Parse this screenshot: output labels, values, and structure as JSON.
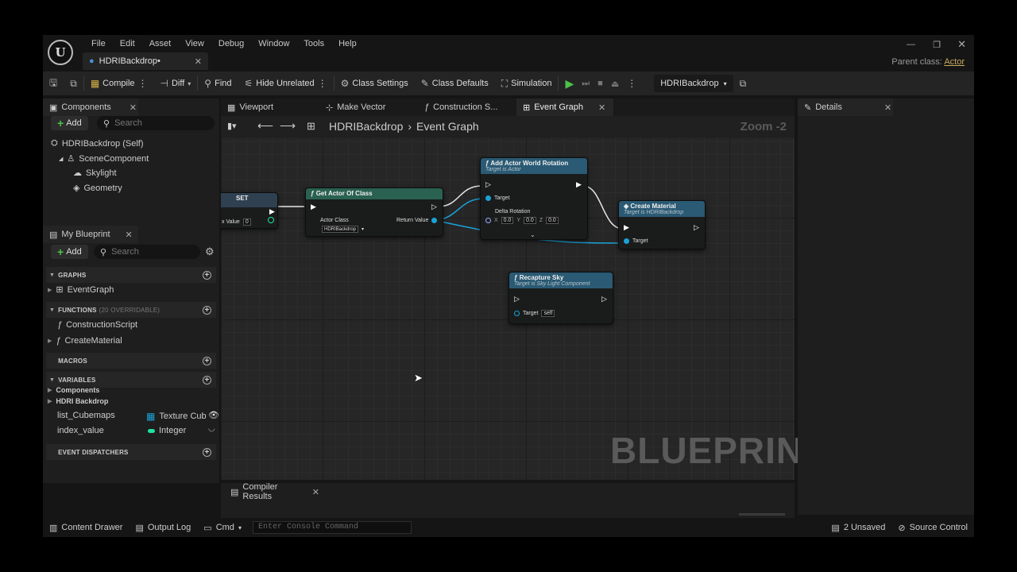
{
  "app": {
    "logo_letter": "U",
    "menu": [
      "File",
      "Edit",
      "Asset",
      "View",
      "Debug",
      "Window",
      "Tools",
      "Help"
    ],
    "doc_tab": "HDRIBackdrop•",
    "parent_class_label": "Parent class:",
    "parent_class_value": "Actor"
  },
  "toolbar": {
    "compile": "Compile",
    "diff": "Diff",
    "find": "Find",
    "hide_unrelated": "Hide Unrelated",
    "class_settings": "Class Settings",
    "class_defaults": "Class Defaults",
    "simulation": "Simulation",
    "debug_object": "HDRIBackdrop"
  },
  "components_panel": {
    "title": "Components",
    "add": "Add",
    "search_placeholder": "Search",
    "tree": [
      "HDRIBackdrop (Self)",
      "SceneComponent",
      "Skylight",
      "Geometry"
    ]
  },
  "my_blueprint": {
    "title": "My Blueprint",
    "add": "Add",
    "search_placeholder": "Search",
    "graphs_header": "GRAPHS",
    "graphs": [
      "EventGraph"
    ],
    "functions_header": "FUNCTIONS",
    "functions_overridable": "(20 OVERRIDABLE)",
    "functions": [
      "ConstructionScript",
      "CreateMaterial"
    ],
    "macros_header": "MACROS",
    "variables_header": "VARIABLES",
    "variable_categories": [
      "Components",
      "HDRI Backdrop"
    ],
    "variables": [
      {
        "name": "list_Cubemaps",
        "type": "Texture Cub",
        "color": "#1aa2d8"
      },
      {
        "name": "index_value",
        "type": "Integer",
        "color": "#1fe0a0"
      }
    ],
    "dispatchers_header": "EVENT DISPATCHERS"
  },
  "editor_tabs": [
    "Viewport",
    "Make Vector",
    "Construction S...",
    "Event Graph"
  ],
  "graph": {
    "breadcrumb_root": "HDRIBackdrop",
    "breadcrumb_leaf": "Event Graph",
    "zoom": "Zoom -2",
    "watermark": "BLUEPRINT",
    "nodes": {
      "set": {
        "title": "SET",
        "pin": "x Value",
        "value": "0"
      },
      "get_actor": {
        "title": "Get Actor Of Class",
        "in_pin": "Actor Class",
        "class_value": "HDRIBackdrop",
        "out_pin": "Return Value"
      },
      "add_rotation": {
        "title": "Add Actor World Rotation",
        "subtitle": "Target is Actor",
        "target": "Target",
        "delta": "Delta Rotation",
        "x": "0.0",
        "y": "0.0",
        "z": "0.0",
        "x_label": "X",
        "y_label": "Y",
        "z_label": "Z"
      },
      "create_material": {
        "title": "Create Material",
        "subtitle": "Target is HDRIBackdrop",
        "target": "Target"
      },
      "recapture": {
        "title": "Recapture Sky",
        "subtitle": "Target is Sky Light Component",
        "target": "Target",
        "value": "self"
      }
    }
  },
  "details_panel": {
    "title": "Details"
  },
  "compiler_results": "Compiler Results",
  "status": {
    "content_drawer": "Content Drawer",
    "output_log": "Output Log",
    "cmd": "Cmd",
    "console_placeholder": "Enter Console Command",
    "unsaved": "2 Unsaved",
    "source_control": "Source Control"
  },
  "colors": {
    "accent_green": "#4cc24c",
    "pin_blue": "#1aa2d8",
    "function_header": "#2a5a74",
    "parent_class": "#c9a95d"
  }
}
